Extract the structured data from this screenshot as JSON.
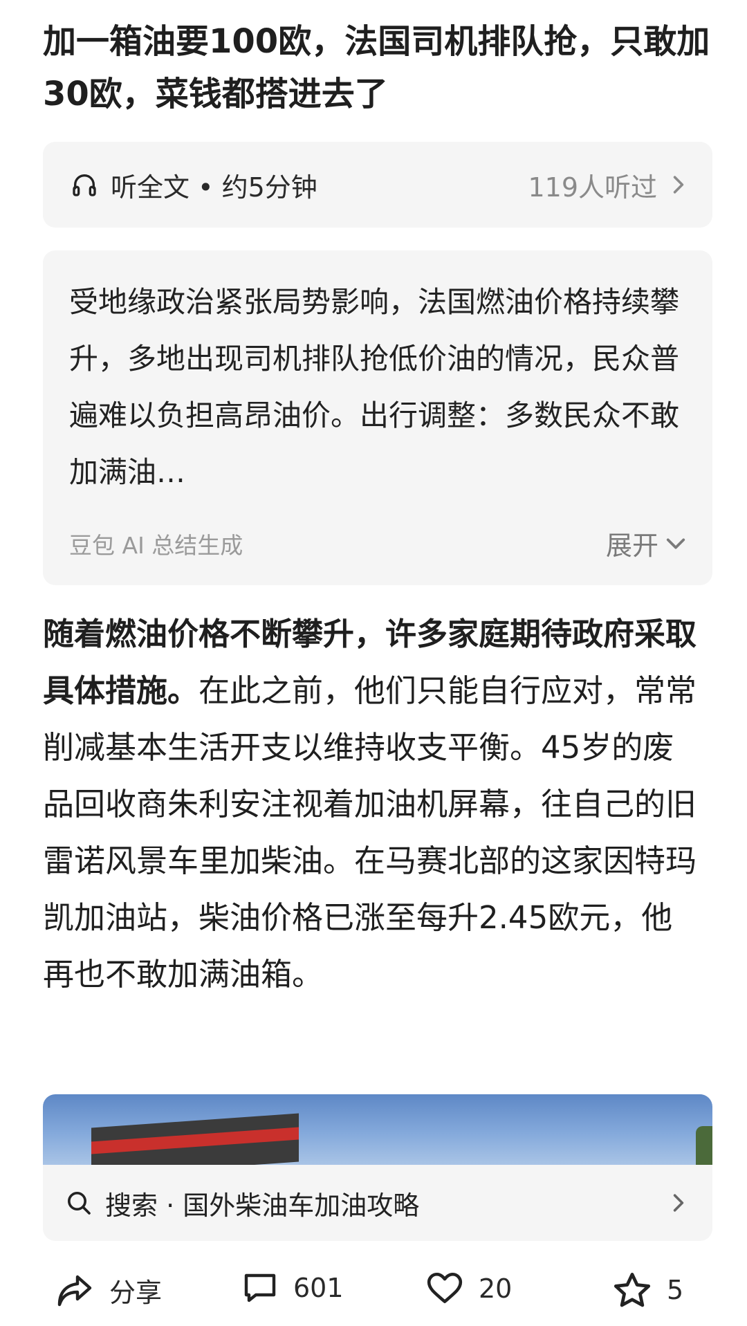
{
  "article": {
    "title": "加一箱油要100欧，法国司机排队抢，只敢加30欧，菜钱都搭进去了"
  },
  "listen": {
    "label": "听全文 • 约5分钟",
    "listeners": "119人听过"
  },
  "summary": {
    "text": "受地缘政治紧张局势影响，法国燃油价格持续攀升，多地出现司机排队抢低价油的情况，民众普遍难以负担高昂油价。出行调整：多数民众不敢加满油…",
    "source": "豆包 AI 总结生成",
    "expand_label": "展开"
  },
  "body": {
    "lead": "随着燃油价格不断攀升，许多家庭期待政府采取具体措施。",
    "rest": "在此之前，他们只能自行应对，常常削减基本生活开支以维持收支平衡。45岁的废品回收商朱利安注视着加油机屏幕，往自己的旧雷诺风景车里加柴油。在马赛北部的这家因特玛凯加油站，柴油价格已涨至每升2.45欧元，他再也不敢加满油箱。"
  },
  "search": {
    "text": "搜索 · 国外柴油车加油攻略",
    "icon": "search-icon"
  },
  "actions": {
    "share_label": "分享",
    "comments": "601",
    "likes": "20",
    "favorites": "5"
  }
}
